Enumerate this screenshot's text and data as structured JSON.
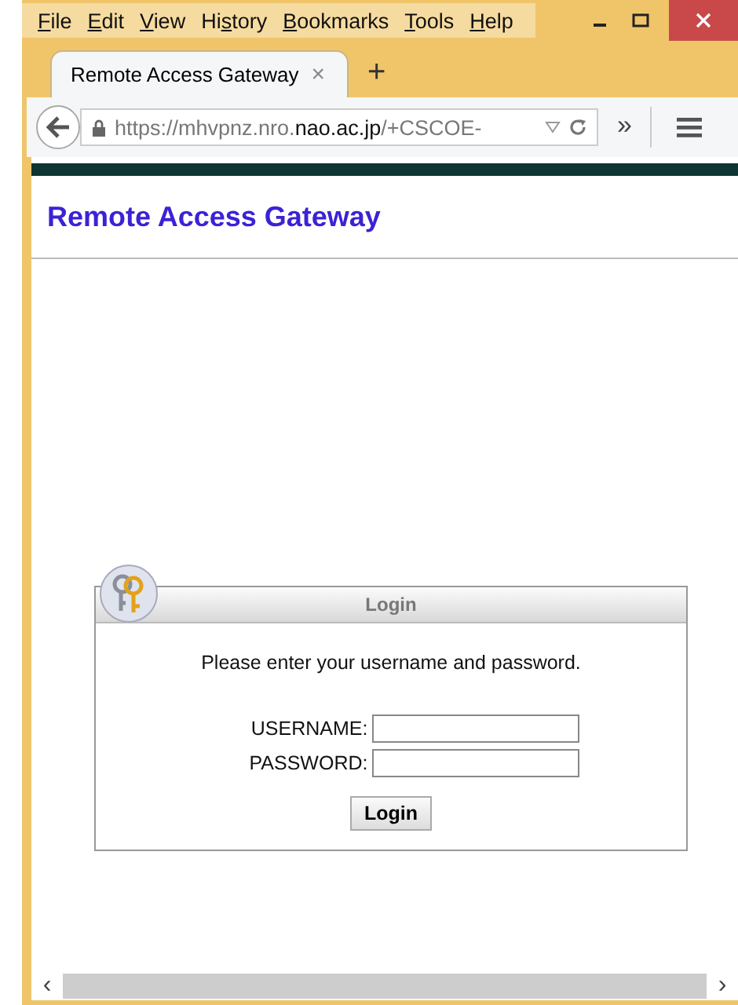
{
  "menu": [
    {
      "key": "F",
      "post": "ile"
    },
    {
      "key": "E",
      "post": "dit"
    },
    {
      "key": "V",
      "post": "iew"
    },
    {
      "pre": "Hi",
      "key": "s",
      "post": "tory"
    },
    {
      "key": "B",
      "post": "ookmarks"
    },
    {
      "key": "T",
      "post": "ools"
    },
    {
      "key": "H",
      "post": "elp"
    }
  ],
  "tabs": [
    {
      "title": "Remote Access Gateway",
      "selected": true,
      "close": "×"
    }
  ],
  "new_tab": "+",
  "url": [
    {
      "kind": "faint",
      "text": "https://mhvpnz.nro."
    },
    {
      "kind": "domain",
      "text": "nao.ac.jp"
    },
    {
      "kind": "faint",
      "text": "/+CSCOE-"
    }
  ],
  "overflow": "»",
  "page": {
    "heading": "Remote Access Gateway",
    "login": {
      "title": "Login",
      "prompt": "Please enter your username and password.",
      "fields": [
        {
          "label": "USERNAME:"
        },
        {
          "label": "PASSWORD:"
        }
      ],
      "button": "Login"
    }
  },
  "scrollbar": {
    "left": "‹",
    "right": "›"
  }
}
